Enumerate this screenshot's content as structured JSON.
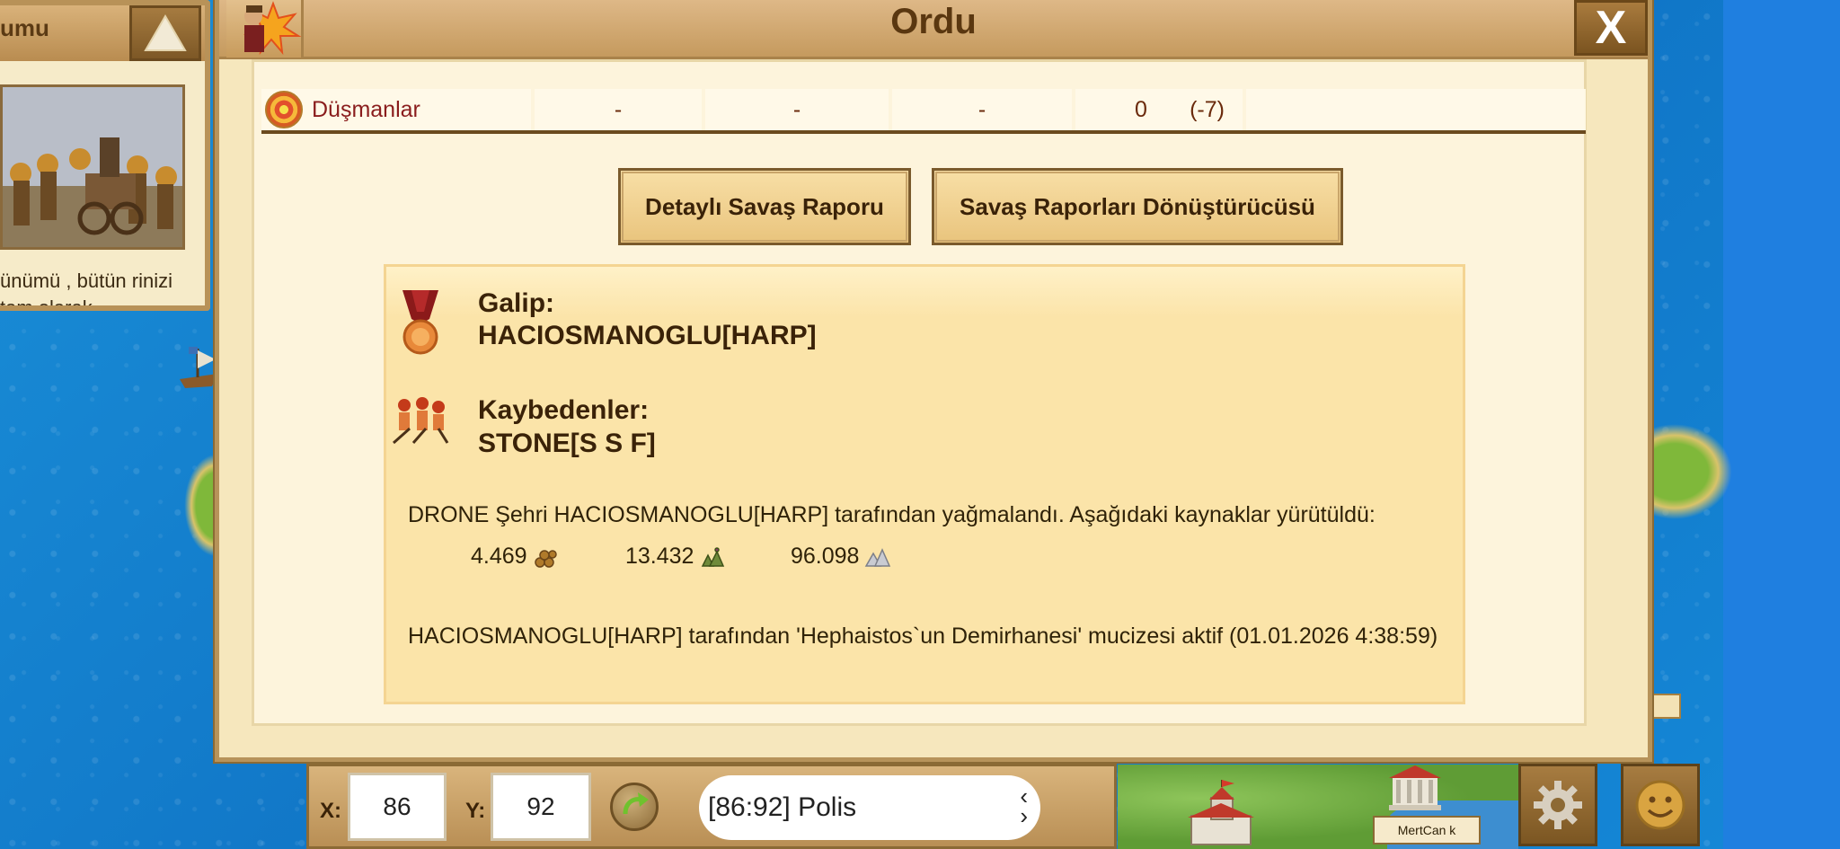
{
  "side_panel": {
    "title_fragment": "umu",
    "text": "ünümü , bütün rinizi tam olarak"
  },
  "dialog": {
    "title": "Ordu",
    "close_label": "X"
  },
  "enemy_row": {
    "label": "Düşmanlar",
    "col1": "-",
    "col2": "-",
    "col3": "-",
    "col4_value": "0",
    "col4_delta": "(-7)"
  },
  "buttons": {
    "detail": "Detaylı Savaş Raporu",
    "converter": "Savaş Raporları Dönüştürücüsü"
  },
  "report": {
    "winner_label": "Galip:",
    "winner_name": "HACIOSMANOGLU[HARP]",
    "losers_label": "Kaybedenler:",
    "losers_name": "STONE[S S F]",
    "loot_text": "DRONE Şehri HACIOSMANOGLU[HARP] tarafından yağmalandı. Aşağıdaki kaynaklar yürütüldü:",
    "resources": [
      {
        "amount": "4.469",
        "icon": "wood-icon"
      },
      {
        "amount": "13.432",
        "icon": "stone-icon"
      },
      {
        "amount": "96.098",
        "icon": "silver-icon"
      }
    ],
    "wonder_text": "HACIOSMANOGLU[HARP] tarafından 'Hephaistos`un Demirhanesi' mucizesi aktif (01.01.2026 4:38:59)"
  },
  "bottom_bar": {
    "x_label": "X:",
    "x_value": "86",
    "y_label": "Y:",
    "y_value": "92",
    "city_select": "[86:92] Polis"
  },
  "map": {
    "player_tag": "MertCan k"
  }
}
